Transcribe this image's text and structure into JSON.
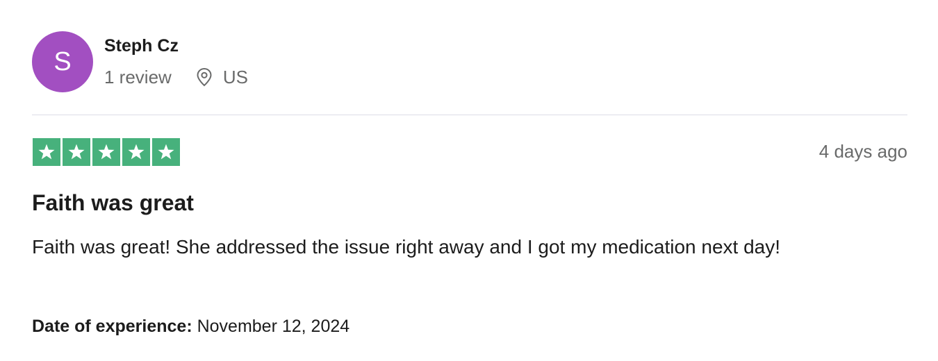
{
  "consumer": {
    "avatar_initial": "S",
    "avatar_color": "#a24fc1",
    "name": "Steph Cz",
    "review_count": "1 review",
    "location_icon": "location-pin-icon",
    "country": "US"
  },
  "review": {
    "rating": 5,
    "rating_max": 5,
    "star_color": "#47b17c",
    "posted": "4 days ago",
    "title": "Faith was great",
    "body": "Faith was great! She addressed the issue right away and I got my medication next day!",
    "date_of_experience_label": "Date of experience:",
    "date_of_experience": "November 12, 2024"
  }
}
